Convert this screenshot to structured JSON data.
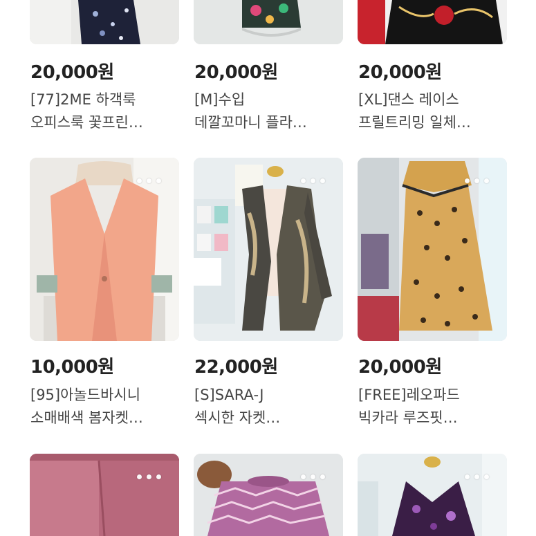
{
  "products": [
    {
      "price": "20,000원",
      "line1": "[77]2ME 하객룩",
      "line2": "오피스룩 꽃프린…"
    },
    {
      "price": "20,000원",
      "line1": "[M]수입",
      "line2": "데깔꼬마니 플라…"
    },
    {
      "price": "20,000원",
      "line1": "[XL]댄스 레이스",
      "line2": "프릴트리밍 일체…"
    },
    {
      "price": "10,000원",
      "line1": "[95]아놀드바시니",
      "line2": "소매배색 봄자켓…"
    },
    {
      "price": "22,000원",
      "line1": "[S]SARA-J",
      "line2": "섹시한 자켓…"
    },
    {
      "price": "20,000원",
      "line1": "[FREE]레오파드",
      "line2": "빅카라 루즈핏…"
    },
    {
      "price": "",
      "line1": "",
      "line2": ""
    },
    {
      "price": "",
      "line1": "",
      "line2": ""
    },
    {
      "price": "",
      "line1": "",
      "line2": ""
    }
  ],
  "icons": {
    "more": "more-dots-icon"
  },
  "colors": {
    "price_text": "#222222",
    "title_text": "#444444"
  }
}
